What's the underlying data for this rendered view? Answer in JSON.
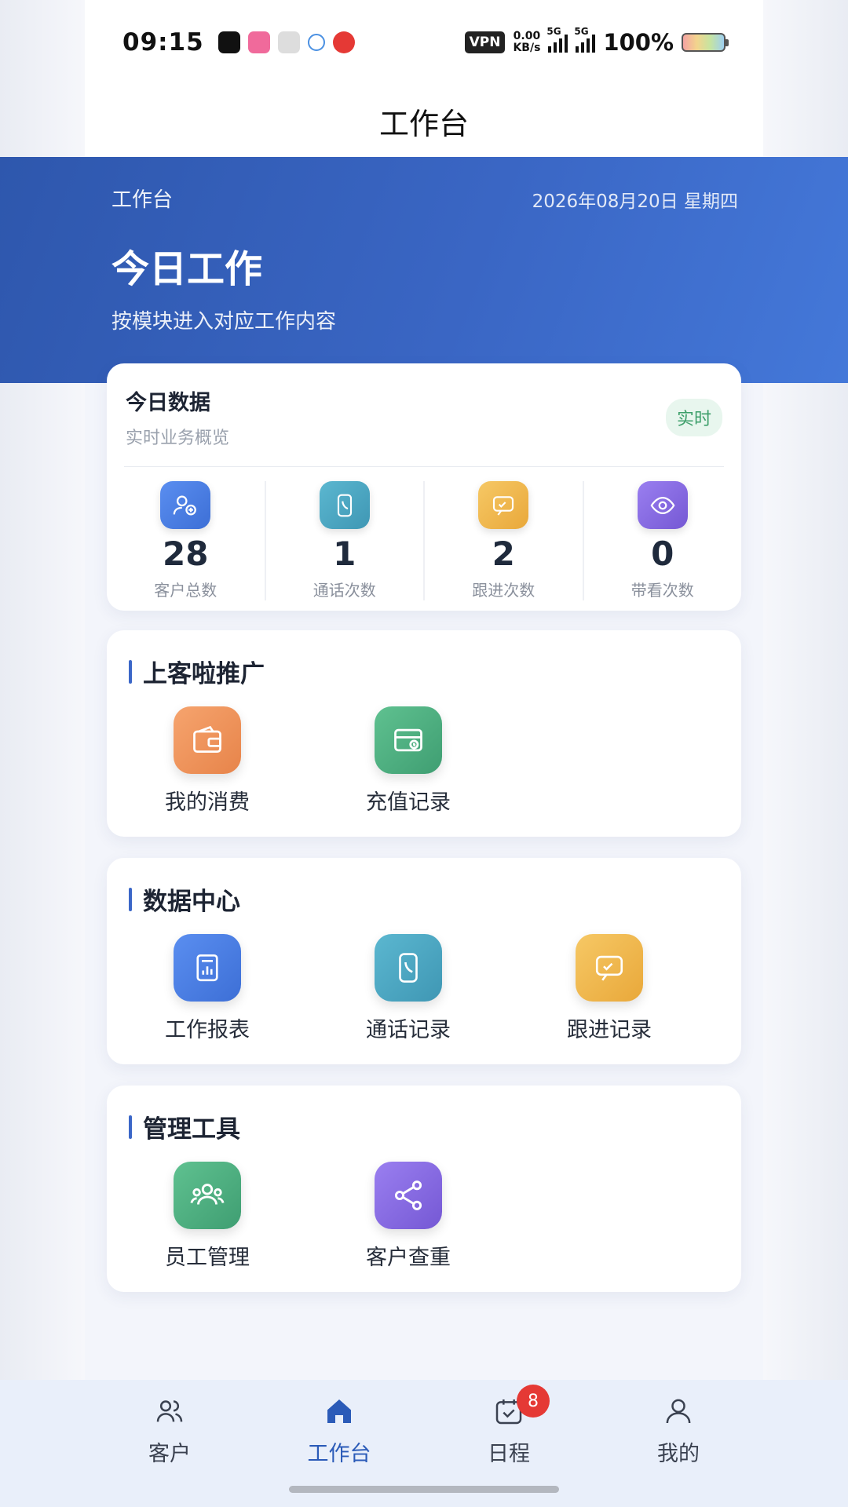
{
  "status_bar": {
    "time": "09:15",
    "vpn": "VPN",
    "speed_value": "0.00",
    "speed_unit": "KB/s",
    "network_1": "5G",
    "network_2": "5G",
    "battery": "100%"
  },
  "header": {
    "title": "工作台"
  },
  "hero": {
    "label": "工作台",
    "date": "2026年08月20日 星期四",
    "title": "今日工作",
    "subtitle": "按模块进入对应工作内容"
  },
  "stats": {
    "title": "今日数据",
    "subtitle": "实时业务概览",
    "badge": "实时",
    "items": [
      {
        "value": "28",
        "label": "客户总数",
        "icon": "user-add-icon",
        "color": "#4a7fe0"
      },
      {
        "value": "1",
        "label": "通话次数",
        "icon": "phone-icon",
        "color": "#4aa6c2"
      },
      {
        "value": "2",
        "label": "跟进次数",
        "icon": "message-icon",
        "color": "#f0b94d"
      },
      {
        "value": "0",
        "label": "带看次数",
        "icon": "eye-icon",
        "color": "#8a6fe0"
      }
    ]
  },
  "sections": [
    {
      "title": "上客啦推广",
      "items": [
        {
          "label": "我的消费",
          "icon": "wallet-icon",
          "color": "#ef935a"
        },
        {
          "label": "充值记录",
          "icon": "card-icon",
          "color": "#4eae82"
        }
      ]
    },
    {
      "title": "数据中心",
      "items": [
        {
          "label": "工作报表",
          "icon": "report-icon",
          "color": "#4a7fe0"
        },
        {
          "label": "通话记录",
          "icon": "phone-icon",
          "color": "#4aa6c2"
        },
        {
          "label": "跟进记录",
          "icon": "message-icon",
          "color": "#f0b94d"
        }
      ]
    },
    {
      "title": "管理工具",
      "items": [
        {
          "label": "员工管理",
          "icon": "team-icon",
          "color": "#4eae82"
        },
        {
          "label": "客户查重",
          "icon": "share-icon",
          "color": "#8a6fe0"
        }
      ]
    }
  ],
  "bottom_nav": {
    "items": [
      {
        "label": "客户",
        "icon": "users-icon"
      },
      {
        "label": "工作台",
        "icon": "home-icon",
        "active": true
      },
      {
        "label": "日程",
        "icon": "calendar-icon",
        "badge": "8"
      },
      {
        "label": "我的",
        "icon": "person-icon"
      }
    ]
  }
}
